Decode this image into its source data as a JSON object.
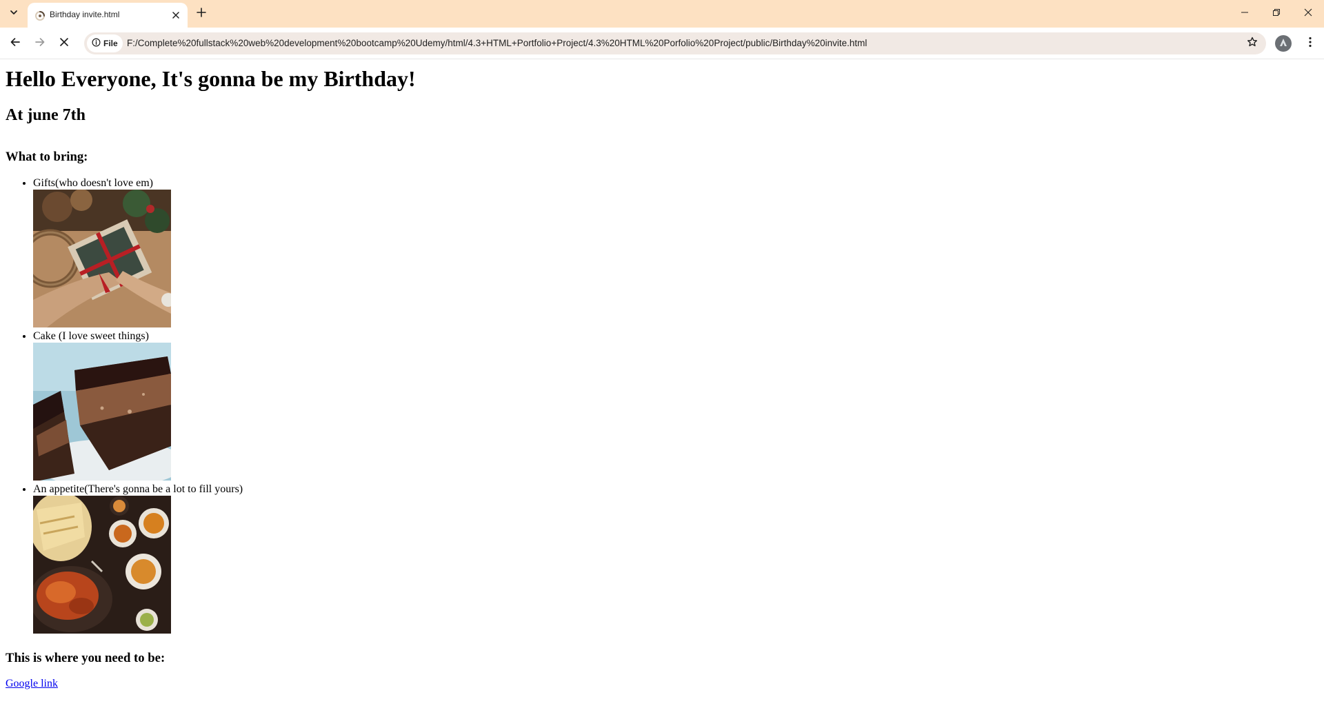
{
  "browser": {
    "tab": {
      "title": "Birthday invite.html"
    },
    "address_bar": {
      "site_chip_label": "File",
      "url": "F:/Complete%20fullstack%20web%20development%20bootcamp%20Udemy/html/4.3+HTML+Portfolio+Project/4.3%20HTML%20Porfolio%20Project/public/Birthday%20invite.html"
    },
    "icons": {
      "tab_search": "chevron-down-icon",
      "tab_close": "close-icon",
      "new_tab": "plus-icon",
      "back": "arrow-left-icon",
      "forward": "arrow-right-icon",
      "stop": "close-icon",
      "site_info": "info-icon",
      "bookmark": "star-icon",
      "profile": "avatar-icon",
      "menu": "more-vertical-icon",
      "minimize": "minimize-icon",
      "restore": "restore-icon",
      "close_window": "close-icon"
    },
    "colors": {
      "tabbar_bg": "#fde1c2",
      "omnibox_bg": "#f1e9e4"
    }
  },
  "page": {
    "heading": "Hello Everyone, It's gonna be my Birthday!",
    "date_heading": "At june 7th",
    "bring_heading": "What to bring:",
    "items": [
      {
        "label": "Gifts(who doesn't love em)",
        "image": "gift-wrapping-photo"
      },
      {
        "label": "Cake (I love sweet things)",
        "image": "chocolate-cake-photo"
      },
      {
        "label": "An appetite(There's gonna be a lot to fill yours)",
        "image": "food-spread-photo"
      }
    ],
    "location_heading": "This is where you need to be:",
    "link_text": "Google link",
    "link_color": "#0000ee"
  }
}
